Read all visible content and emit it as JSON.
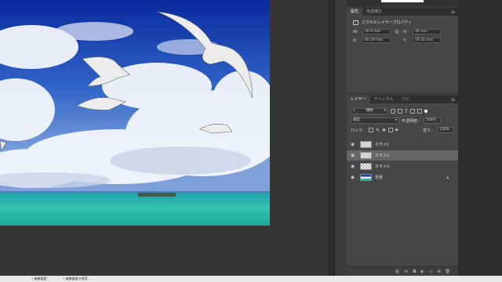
{
  "colors": {
    "workspace": "#353535",
    "panel": "#464646",
    "sky_top": "#0a2fa3",
    "sea": "#22b8a9",
    "selected_layer": "#666666"
  },
  "properties_panel": {
    "tabs": [
      "属性",
      "色調補正"
    ],
    "title": "ピクセルレイヤープロパティ",
    "icon": "pixel-layer-icon",
    "W_label": "W:",
    "W_value": "30.9 mm",
    "H_label": "H:",
    "H_value": "39 mm",
    "X_label": "X:",
    "X_value": "85.29 mm",
    "Y_label": "Y:",
    "Y_value": "29.32 mm"
  },
  "layers_panel": {
    "tabs": [
      "レイヤー",
      "チャンネル",
      "パス"
    ],
    "filter_label": "種類",
    "blend_mode": "通常",
    "opacity_label": "不透明度：",
    "opacity_value": "100%",
    "lock_label": "ロック：",
    "fill_label": "塗り：",
    "fill_value": "100%",
    "layers": [
      {
        "name": "カモメ1",
        "selected": false,
        "type": "transparent"
      },
      {
        "name": "カモメ2",
        "selected": true,
        "type": "transparent"
      },
      {
        "name": "カモメ3",
        "selected": false,
        "type": "transparent"
      },
      {
        "name": "背景",
        "selected": false,
        "type": "photo",
        "locked": true
      }
    ],
    "footer_icons": [
      "link-icon",
      "fx-icon",
      "mask-icon",
      "adjustment-icon",
      "folder-icon",
      "new-layer-icon",
      "trash-icon"
    ]
  },
  "taskbar": {
    "items": [
      "•  編集履歴",
      "•  編集履歴の使用  ..."
    ]
  }
}
